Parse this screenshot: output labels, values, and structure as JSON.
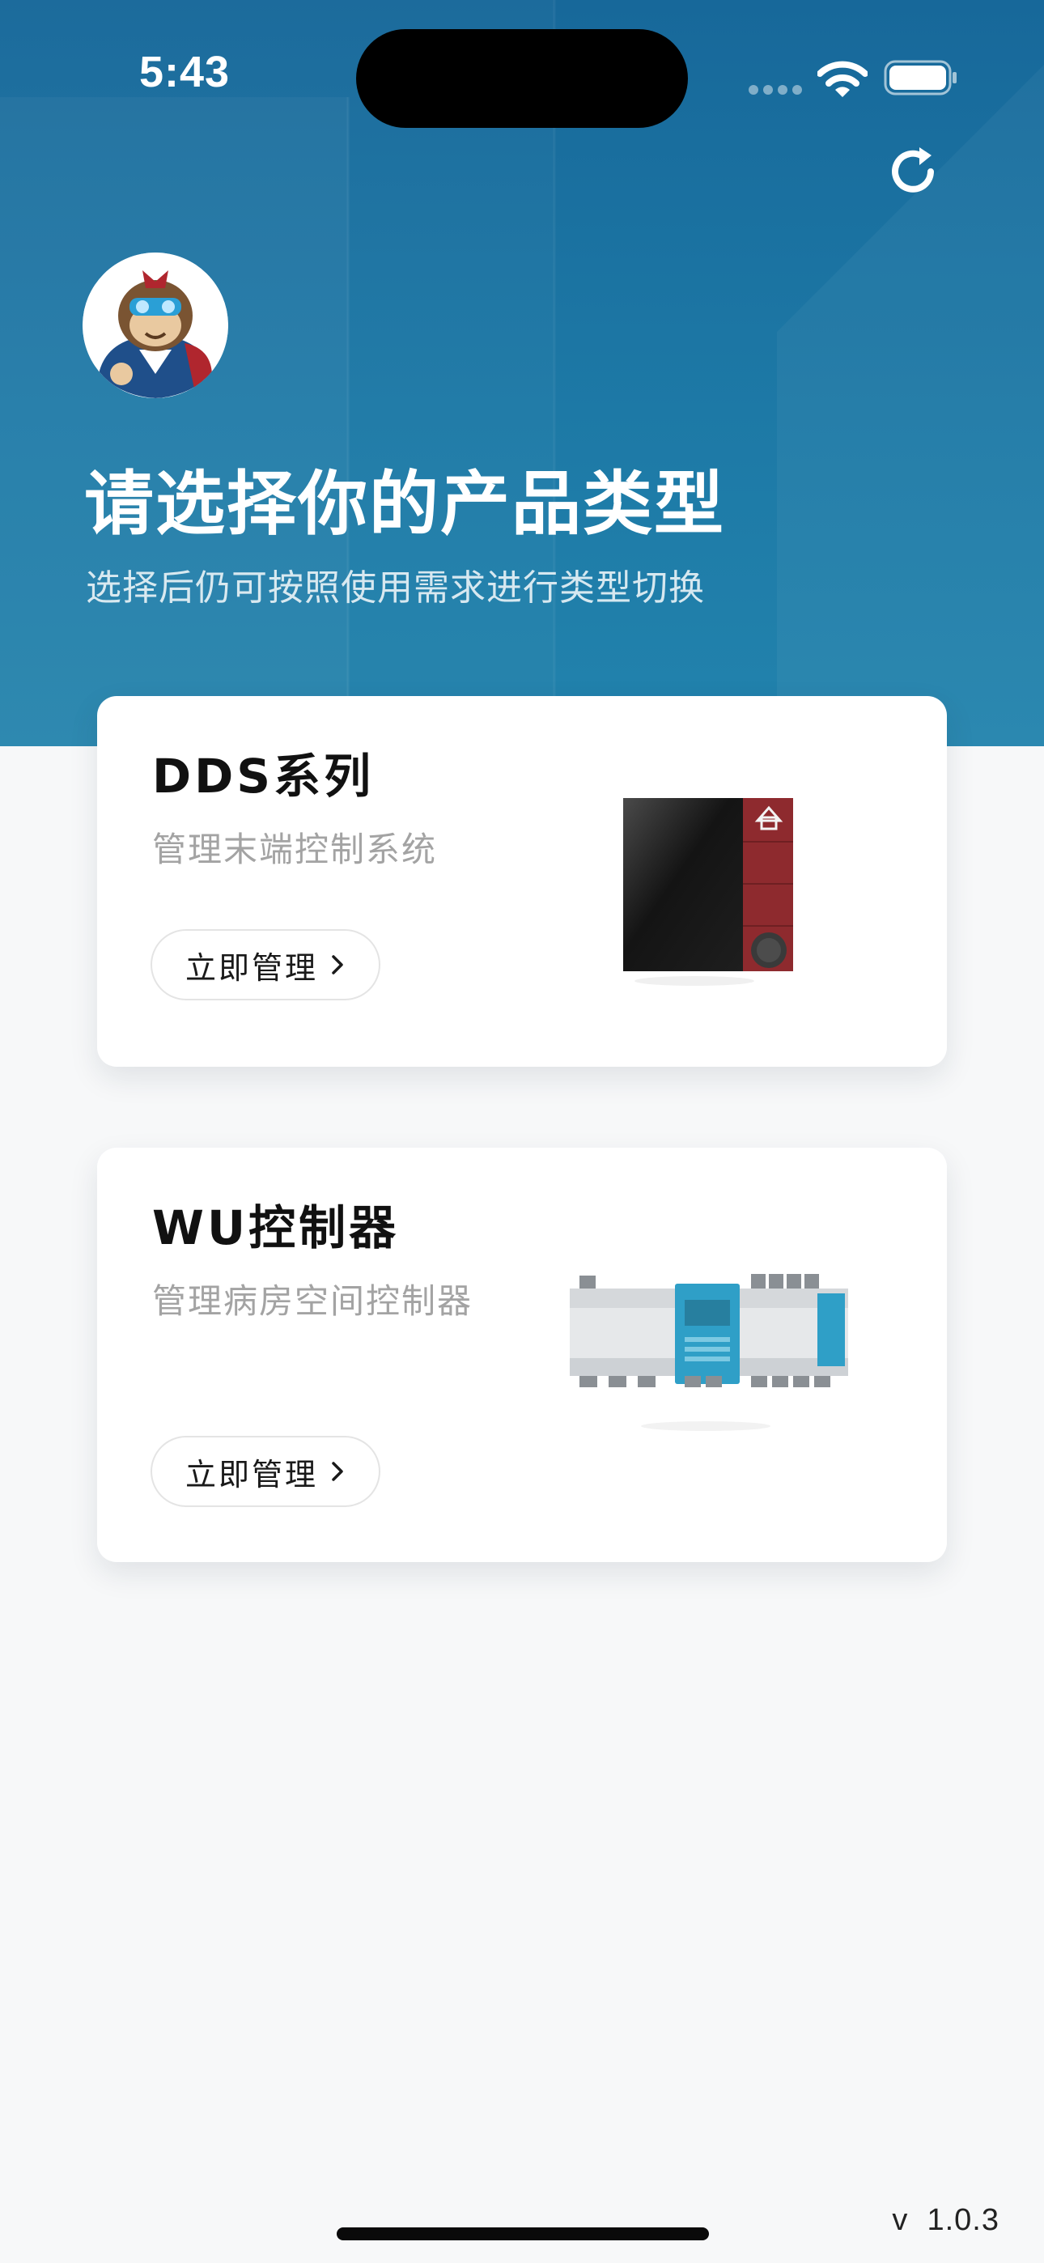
{
  "status_bar": {
    "time": "5:43"
  },
  "header": {
    "refresh_icon": "refresh-icon",
    "avatar_icon": "monkey-mascot-avatar",
    "title": "请选择你的产品类型",
    "subtitle": "选择后仍可按照使用需求进行类型切换"
  },
  "products": [
    {
      "title": "DDS系列",
      "description": "管理末端控制系统",
      "button_label": "立即管理",
      "image_icon": "dds-panel-device"
    },
    {
      "title": "WU控制器",
      "description": "管理病房空间控制器",
      "button_label": "立即管理",
      "image_icon": "wu-din-rail-controller"
    }
  ],
  "footer": {
    "version": "v  1.0.3"
  },
  "colors": {
    "header_bg": "#1d79a6",
    "page_bg": "#f7f8f9",
    "card_bg": "#ffffff",
    "muted_text": "#a3a3a3"
  }
}
